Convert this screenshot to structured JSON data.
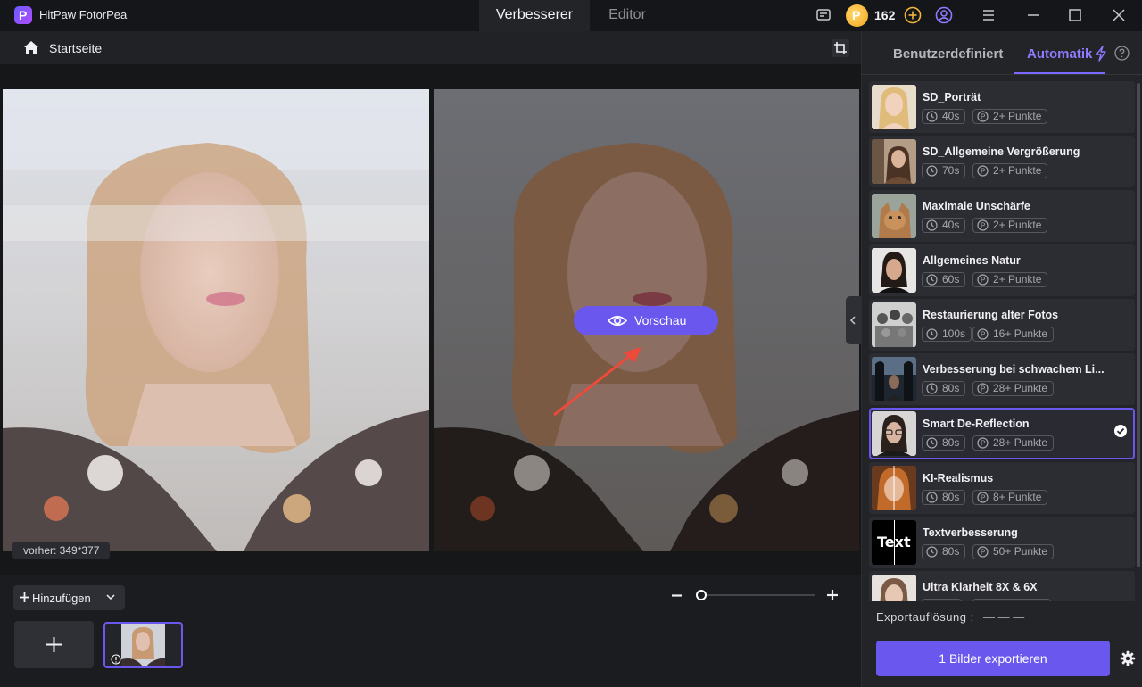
{
  "app": {
    "title": "HitPaw FotorPea",
    "coins": "162"
  },
  "modes": [
    {
      "label": "Verbesserer"
    },
    {
      "label": "Editor"
    }
  ],
  "toolbar": {
    "home": "Startseite"
  },
  "canvas": {
    "size_tag": "vorher: 349*377",
    "preview": "Vorschau"
  },
  "bottom": {
    "add": "Hinzufügen"
  },
  "panel": {
    "tab_custom": "Benutzerdefiniert",
    "tab_auto": "Automatik",
    "models": [
      {
        "name": "SD_Porträt",
        "time": "40s",
        "points": "2+ Punkte",
        "thumb": "portrait-blonde"
      },
      {
        "name": "SD_Allgemeine Vergrößerung",
        "time": "70s",
        "points": "2+ Punkte",
        "thumb": "person-indoor"
      },
      {
        "name": "Maximale Unschärfe",
        "time": "40s",
        "points": "2+ Punkte",
        "thumb": "cat"
      },
      {
        "name": "Allgemeines Natur",
        "time": "60s",
        "points": "2+ Punkte",
        "thumb": "portrait-dark"
      },
      {
        "name": "Restaurierung alter Fotos",
        "time": "100s",
        "points": "16+ Punkte",
        "thumb": "old-photo"
      },
      {
        "name": "Verbesserung bei schwachem Li...",
        "time": "80s",
        "points": "28+ Punkte",
        "thumb": "low-light"
      },
      {
        "name": "Smart De-Reflection",
        "time": "80s",
        "points": "28+ Punkte",
        "thumb": "glasses-portrait",
        "selected": true
      },
      {
        "name": "KI-Realismus",
        "time": "80s",
        "points": "8+ Punkte",
        "thumb": "ai-portrait"
      },
      {
        "name": "Textverbesserung",
        "time": "80s",
        "points": "50+ Punkte",
        "thumb": "text",
        "thumb_text": "Text"
      },
      {
        "name": "Ultra Klarheit 8X & 6X",
        "time": "",
        "points": "",
        "thumb": "portrait-light"
      }
    ],
    "export_label": "Exportauflösung :",
    "export_value": "— — —",
    "export_button": "1 Bilder exportieren"
  },
  "colors": {
    "accent": "#6a58ee",
    "accent_text": "#8e7bff",
    "background": "#1b1c20"
  }
}
